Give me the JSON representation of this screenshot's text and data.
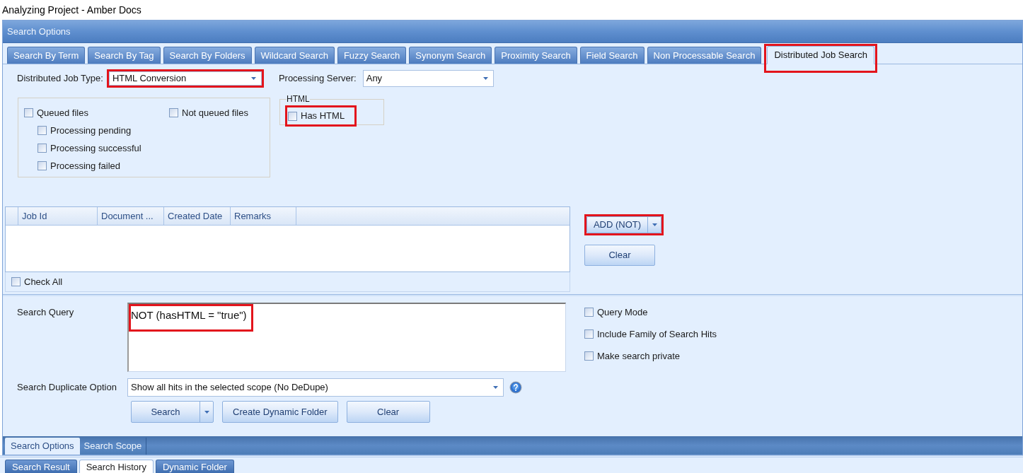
{
  "window": {
    "title": "Analyzing Project - Amber Docs"
  },
  "panel": {
    "title": "Search Options"
  },
  "tabs": [
    {
      "label": "Search By Term",
      "selected": false,
      "highlighted": false
    },
    {
      "label": "Search By Tag",
      "selected": false,
      "highlighted": false
    },
    {
      "label": "Search By Folders",
      "selected": false,
      "highlighted": false
    },
    {
      "label": "Wildcard Search",
      "selected": false,
      "highlighted": false
    },
    {
      "label": "Fuzzy Search",
      "selected": false,
      "highlighted": false
    },
    {
      "label": "Synonym Search",
      "selected": false,
      "highlighted": false
    },
    {
      "label": "Proximity Search",
      "selected": false,
      "highlighted": false
    },
    {
      "label": "Field Search",
      "selected": false,
      "highlighted": false
    },
    {
      "label": "Non Processable Search",
      "selected": false,
      "highlighted": false
    },
    {
      "label": "Distributed Job Search",
      "selected": true,
      "highlighted": true
    }
  ],
  "job_filters": {
    "job_type": {
      "label": "Distributed Job Type:",
      "value": "HTML Conversion",
      "highlighted": true
    },
    "processing_server": {
      "label": "Processing Server:",
      "value": "Any"
    }
  },
  "queue_group": {
    "checkboxes": [
      {
        "label": "Queued files",
        "checked": false,
        "children": [
          {
            "label": "Processing pending",
            "checked": false
          },
          {
            "label": "Processing successful",
            "checked": false
          },
          {
            "label": "Processing failed",
            "checked": false
          }
        ]
      },
      {
        "label": "Not queued files",
        "checked": false
      }
    ]
  },
  "html_group": {
    "title": "HTML",
    "checkboxes": [
      {
        "label": "Has HTML",
        "checked": false,
        "highlighted": true
      }
    ]
  },
  "jobs_table": {
    "columns": [
      "Job Id",
      "Document ...",
      "Created Date",
      "Remarks"
    ],
    "check_all": {
      "label": "Check All",
      "checked": false
    }
  },
  "actions": [
    {
      "label": "ADD (NOT)",
      "kind": "split",
      "highlighted": true
    },
    {
      "label": "Clear",
      "kind": "plain",
      "highlighted": false
    }
  ],
  "search_query": {
    "label": "Search Query",
    "value": "NOT (hasHTML = \"true\")",
    "highlighted": true
  },
  "query_options": [
    {
      "label": "Query Mode",
      "checked": false
    },
    {
      "label": "Include Family of Search Hits",
      "checked": false
    },
    {
      "label": "Make search private",
      "checked": false
    }
  ],
  "duplicate_option": {
    "label": "Search Duplicate Option",
    "value": "Show all hits in the selected scope (No DeDupe)"
  },
  "search_buttons": [
    {
      "label": "Search",
      "kind": "split"
    },
    {
      "label": "Create Dynamic Folder",
      "kind": "plain"
    },
    {
      "label": "Clear",
      "kind": "plain"
    }
  ],
  "panel_tabs": [
    {
      "label": "Search Options",
      "selected": true
    },
    {
      "label": "Search Scope",
      "selected": false
    }
  ],
  "bottom_tabs": [
    {
      "label": "Search Result",
      "selected": false
    },
    {
      "label": "Search History",
      "selected": true
    },
    {
      "label": "Dynamic Folder",
      "selected": false
    }
  ]
}
